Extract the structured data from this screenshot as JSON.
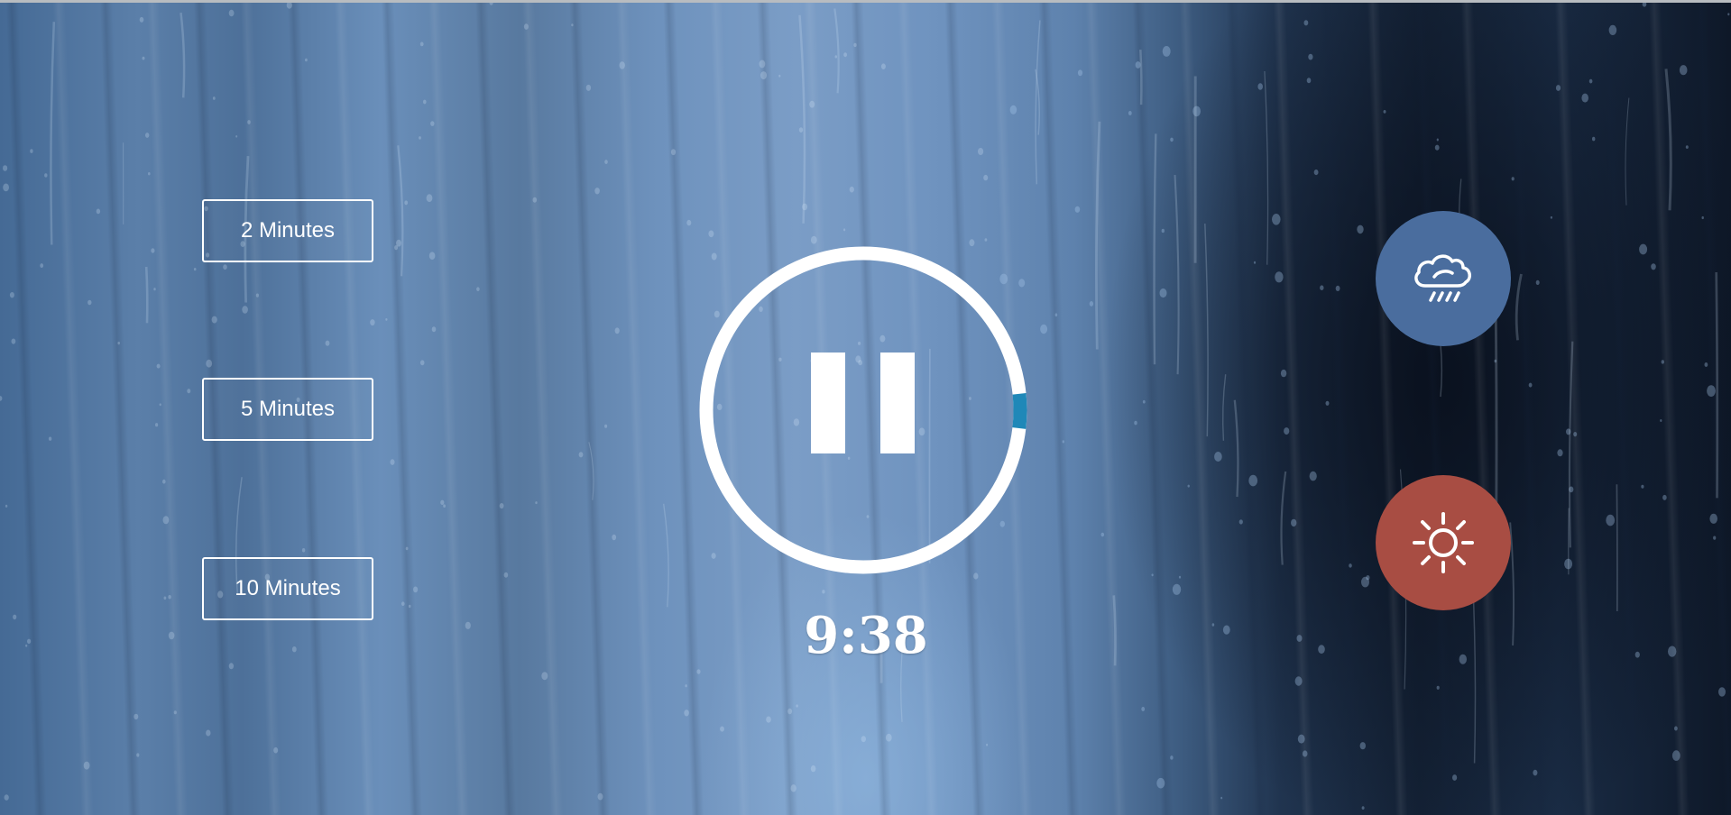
{
  "presets": [
    {
      "label": "2 Minutes"
    },
    {
      "label": "5 Minutes"
    },
    {
      "label": "10 Minutes"
    }
  ],
  "player": {
    "state_icon": "pause-icon",
    "progress": 0.035,
    "ring_color": "#ffffff",
    "progress_color": "#1f88b8"
  },
  "timer": {
    "remaining": "9:38"
  },
  "sounds": [
    {
      "icon": "cloud-rain-icon",
      "color": "#4a6d9e"
    },
    {
      "icon": "sun-icon",
      "color": "#a84d43"
    }
  ]
}
